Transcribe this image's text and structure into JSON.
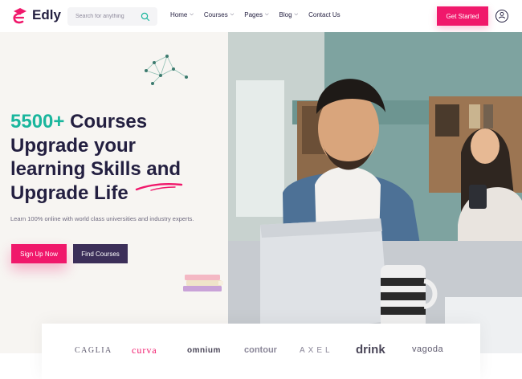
{
  "header": {
    "logo_text": "Edly",
    "search_placeholder": "Search for anything",
    "nav": [
      {
        "label": "Home",
        "has_dropdown": true
      },
      {
        "label": "Courses",
        "has_dropdown": true
      },
      {
        "label": "Pages",
        "has_dropdown": true
      },
      {
        "label": "Blog",
        "has_dropdown": true
      },
      {
        "label": "Contact Us",
        "has_dropdown": false
      }
    ],
    "cta_label": "Get Started"
  },
  "hero": {
    "count": "5500+",
    "title_rest": " Courses",
    "title_line2": "Upgrade your",
    "title_line3": "learning Skills and",
    "title_line4": "Upgrade Life",
    "description": "Learn 100% online with world class universities and industry experts.",
    "primary_button": "Sign Up Now",
    "secondary_button": "Find Courses"
  },
  "brands": [
    "CAGLIA",
    "curva",
    "omnium",
    "contour",
    "AXEL",
    "drink",
    "vagoda"
  ],
  "colors": {
    "accent_pink": "#f0186b",
    "accent_teal": "#1ab69d",
    "heading": "#231f40",
    "dark_button": "#3c2f59",
    "hero_bg": "#f7f5f2"
  },
  "icons": [
    "logo-mortarboard-icon",
    "search-icon",
    "chevron-down-icon",
    "user-icon",
    "network-decoration-icon",
    "books-icon"
  ]
}
